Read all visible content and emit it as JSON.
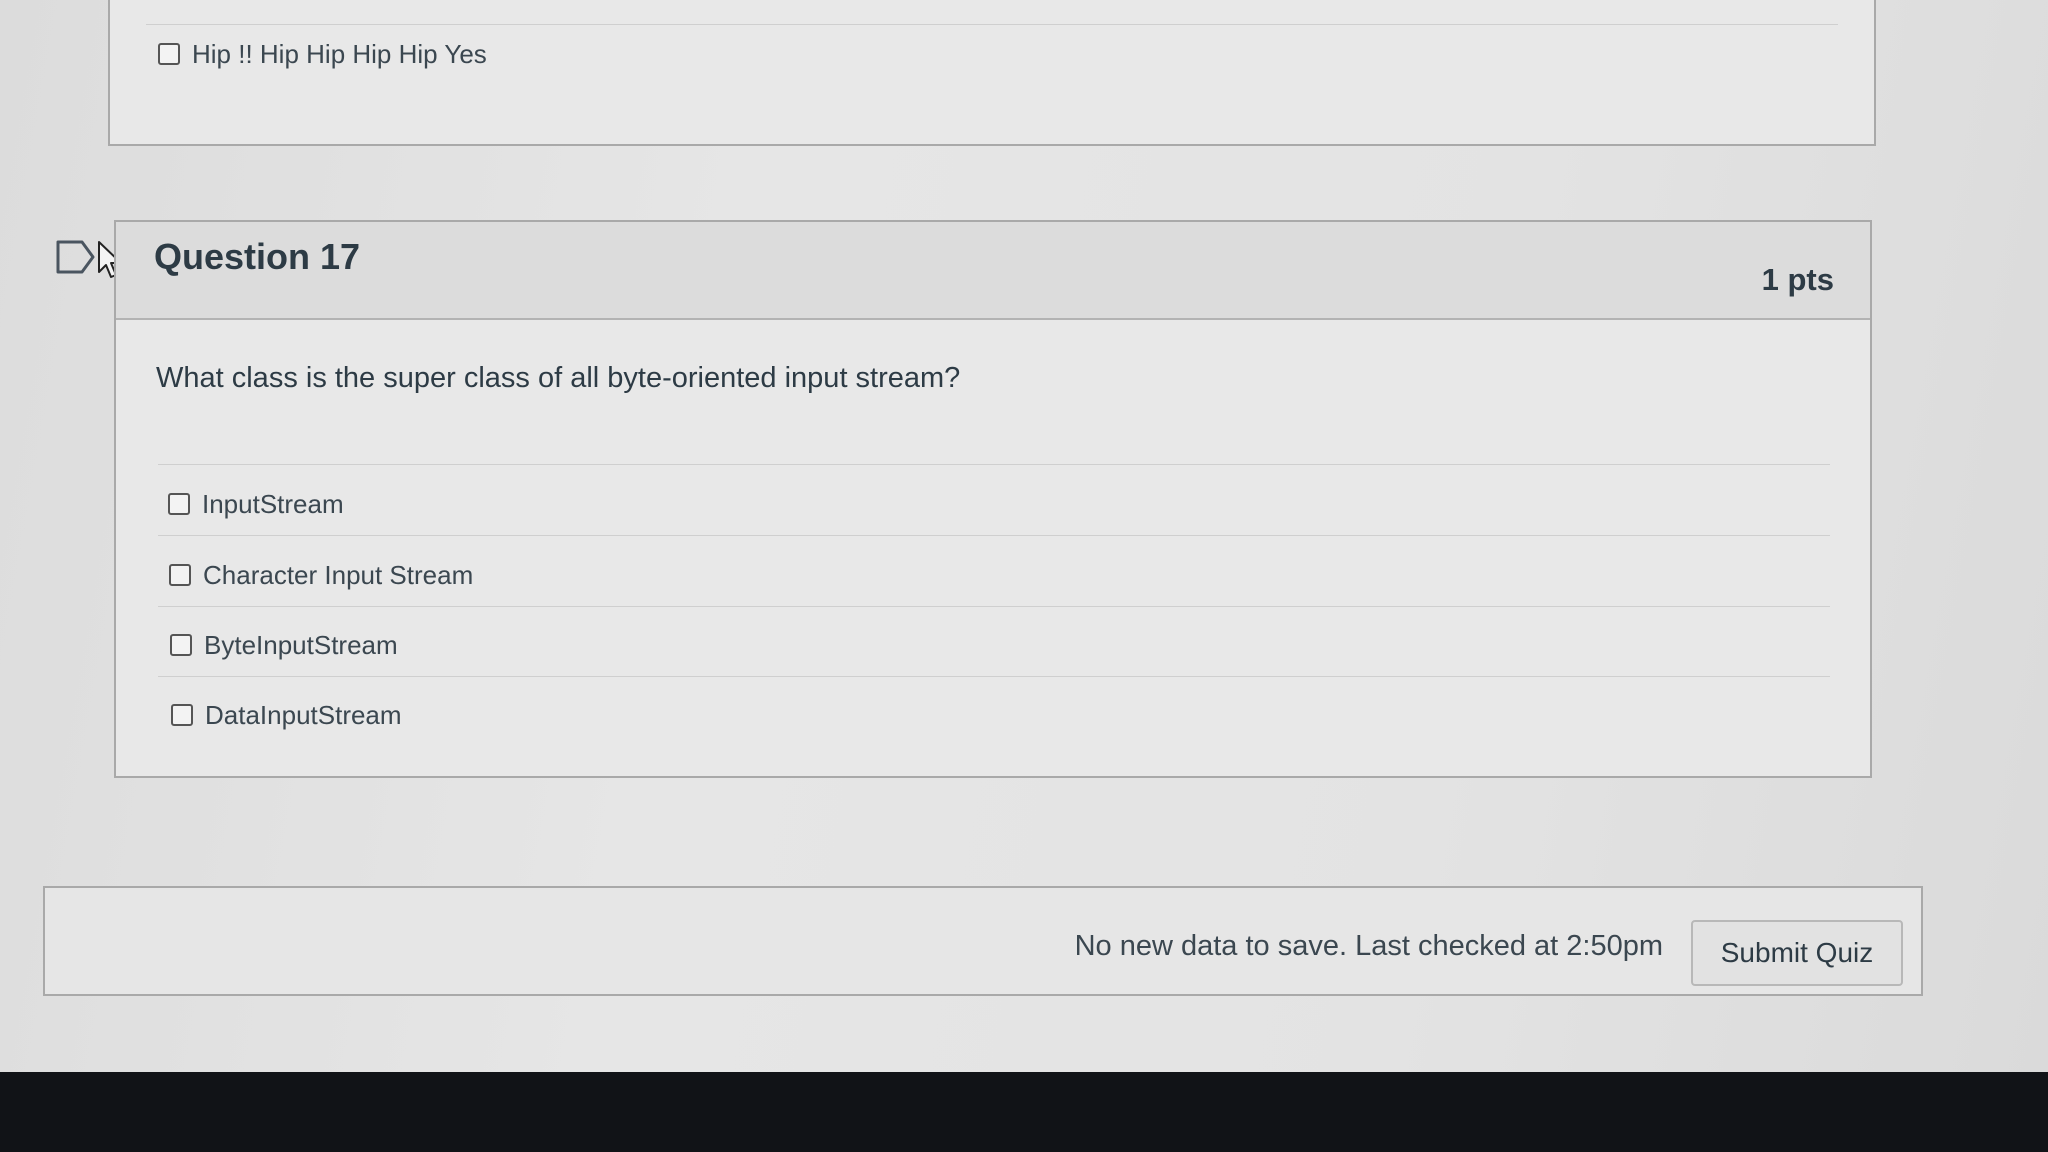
{
  "previous_question": {
    "answers": [
      {
        "label": "Hip !! Hip Hip Hip Hip Yes",
        "checked": false
      }
    ]
  },
  "question": {
    "title": "Question 17",
    "points": "1 pts",
    "text": "What class is the super class of all  byte-oriented input stream?",
    "answers": [
      {
        "label": "InputStream",
        "checked": false
      },
      {
        "label": "Character Input Stream",
        "checked": false
      },
      {
        "label": "ByteInputStream",
        "checked": false
      },
      {
        "label": "DataInputStream",
        "checked": false
      }
    ]
  },
  "footer": {
    "save_status": "No new data to save. Last checked at 2:50pm",
    "submit_label": "Submit Quiz"
  },
  "icons": {
    "flag": "flag-question-icon",
    "cursor": "mouse-pointer-icon"
  }
}
